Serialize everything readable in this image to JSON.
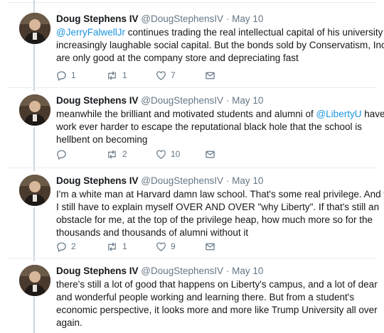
{
  "tweets": [
    {
      "name": "Doug Stephens IV",
      "handle": "@DougStephensIV",
      "dot": "·",
      "date": "May 10",
      "lines": [
        [
          {
            "t": "@JerryFalwellJr",
            "m": true
          },
          {
            "t": " continues trading the real intellectual capital of his university for",
            "m": false
          }
        ],
        [
          {
            "t": "increasingly laughable social capital. But the bonds sold by Conservatism, Inc.",
            "m": false
          }
        ],
        [
          {
            "t": "are only good at the company store and depreciating fast",
            "m": false
          }
        ]
      ],
      "replies": "1",
      "retweets": "1",
      "likes": "7"
    },
    {
      "name": "Doug Stephens IV",
      "handle": "@DougStephensIV",
      "dot": "·",
      "date": "May 10",
      "lines": [
        [
          {
            "t": "meanwhile the brilliant and motivated students and alumni of ",
            "m": false
          },
          {
            "t": "@LibertyU",
            "m": true
          },
          {
            "t": " have to",
            "m": false
          }
        ],
        [
          {
            "t": "work ever harder to escape the reputational black hole that the school is",
            "m": false
          }
        ],
        [
          {
            "t": "hellbent on becoming",
            "m": false
          }
        ]
      ],
      "replies": "",
      "retweets": "2",
      "likes": "10"
    },
    {
      "name": "Doug Stephens IV",
      "handle": "@DougStephensIV",
      "dot": "·",
      "date": "May 10",
      "lines": [
        [
          {
            "t": "I'm a white man at Harvard damn law school. That's some real privilege. And yet",
            "m": false
          }
        ],
        [
          {
            "t": "I still have to explain myself OVER AND OVER \"why Liberty\". If that's still an",
            "m": false
          }
        ],
        [
          {
            "t": "obstacle for me, at the top of the privilege heap, how much more so for the",
            "m": false
          }
        ],
        [
          {
            "t": "thousands and thousands of alumni without it",
            "m": false
          }
        ]
      ],
      "replies": "2",
      "retweets": "1",
      "likes": "9"
    },
    {
      "name": "Doug Stephens IV",
      "handle": "@DougStephensIV",
      "dot": "·",
      "date": "May 10",
      "lines": [
        [
          {
            "t": "there's still a lot of good that happens on Liberty's campus, and a lot of dear",
            "m": false
          }
        ],
        [
          {
            "t": "and wonderful people working and learning there. But from a student's",
            "m": false
          }
        ],
        [
          {
            "t": "economic perspective, it looks more and more like Trump University all over",
            "m": false
          }
        ],
        [
          {
            "t": "again.",
            "m": false
          }
        ]
      ]
    }
  ],
  "icons": {
    "reply": "reply-icon",
    "retweet": "retweet-icon",
    "like": "heart-icon",
    "dm": "envelope-icon"
  },
  "colors": {
    "name": "#14171a",
    "meta": "#657786",
    "mention": "#1b95e0",
    "divider": "#e6ecf0",
    "thread": "#ccd6dd"
  }
}
